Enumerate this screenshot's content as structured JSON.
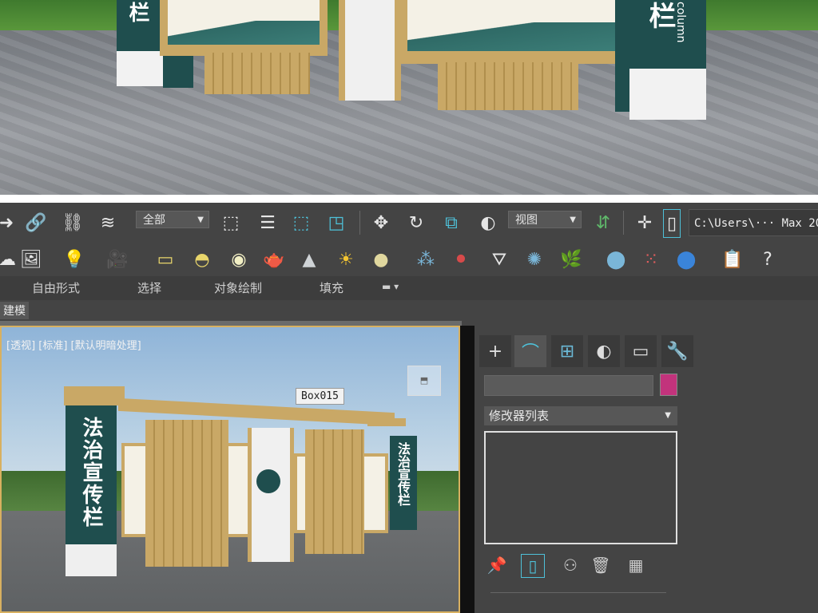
{
  "render_top": {
    "sign_text_left": "栏",
    "sign_text_right": "栏",
    "column_text": "column"
  },
  "toolbar_main": {
    "selection_filter": "全部",
    "reference_coord": "视图",
    "path_text": "C:\\Users\\··· Max 20"
  },
  "ribbon": {
    "tabs": [
      "自由形式",
      "选择",
      "对象绘制",
      "填充"
    ]
  },
  "subbar": {
    "label": "建模"
  },
  "viewport": {
    "label": "[透视] [标准] [默认明暗处理]",
    "object_tag": "Box015",
    "sign_left_title": "法治宣传栏",
    "sign_right_title": "法治宣传栏"
  },
  "command_panel": {
    "modifier_list": "修改器列表",
    "color_hex": "#c2337c"
  }
}
